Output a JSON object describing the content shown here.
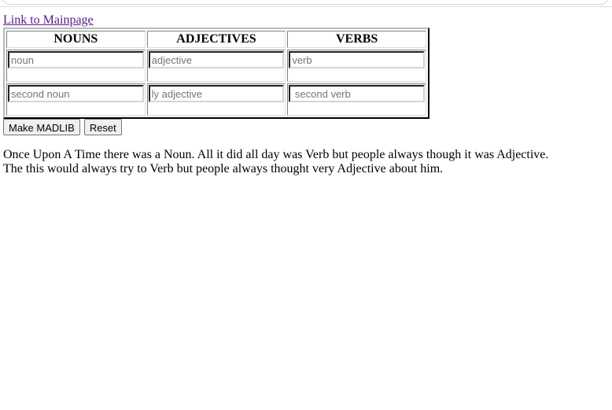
{
  "nav": {
    "main_link": "Link to Mainpage"
  },
  "table": {
    "headers": [
      "NOUNS",
      "ADJECTIVES",
      "VERBS"
    ],
    "rows": [
      {
        "noun_placeholder": "noun",
        "adjective_placeholder": "adjective",
        "verb_placeholder": "verb"
      },
      {
        "noun_placeholder": "second noun",
        "adjective_placeholder": "ly adjective",
        "verb_placeholder": " second verb"
      }
    ]
  },
  "buttons": {
    "make": "Make MADLIB",
    "reset": "Reset"
  },
  "story": {
    "line1": "Once Upon A Time there was a Noun. All it did all day was Verb but people always though it was Adjective.",
    "line2": "The this would always try to Verb but people always thought very Adjective about him."
  },
  "colors": {
    "visited_link": "#551a8b",
    "button_bg": "#efefef",
    "placeholder": "#757575"
  }
}
